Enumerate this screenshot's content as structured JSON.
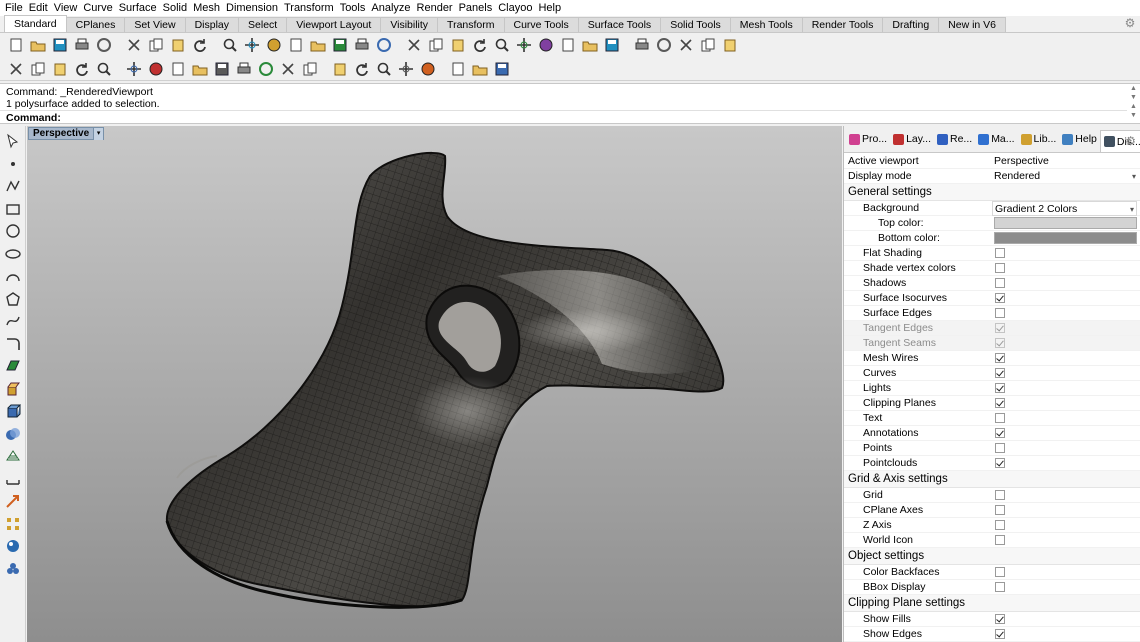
{
  "menu": [
    "File",
    "Edit",
    "View",
    "Curve",
    "Surface",
    "Solid",
    "Mesh",
    "Dimension",
    "Transform",
    "Tools",
    "Analyze",
    "Render",
    "Panels",
    "Clayoo",
    "Help"
  ],
  "tabs": [
    "Standard",
    "CPlanes",
    "Set View",
    "Display",
    "Select",
    "Viewport Layout",
    "Visibility",
    "Transform",
    "Curve Tools",
    "Surface Tools",
    "Solid Tools",
    "Mesh Tools",
    "Render Tools",
    "Drafting",
    "New in V6"
  ],
  "active_tab": "Standard",
  "command": {
    "history": [
      "Command: _RenderedViewport",
      "1 polysurface added to selection."
    ],
    "prompt": "Command:",
    "input_value": ""
  },
  "viewport": {
    "title": "Perspective",
    "menu_arrow": "▾"
  },
  "panel": {
    "tabs": [
      {
        "label": "Pro...",
        "icon": "properties-icon",
        "color": "#d04090"
      },
      {
        "label": "Lay...",
        "icon": "layers-icon",
        "color": "#c03030"
      },
      {
        "label": "Re...",
        "icon": "render-icon",
        "color": "#3060c0"
      },
      {
        "label": "Ma...",
        "icon": "materials-icon",
        "color": "#3070d0"
      },
      {
        "label": "Lib...",
        "icon": "libraries-icon",
        "color": "#d0a030"
      },
      {
        "label": "Help",
        "icon": "help-icon",
        "color": "#4080c0"
      },
      {
        "label": "Dis...",
        "icon": "display-icon",
        "color": "#405060"
      }
    ],
    "active_viewport_label": "Active viewport",
    "active_viewport_value": "Perspective",
    "display_mode_label": "Display mode",
    "display_mode_value": "Rendered",
    "sections": {
      "general": "General settings",
      "grid": "Grid & Axis settings",
      "object": "Object settings",
      "clipping": "Clipping Plane settings"
    },
    "background_label": "Background",
    "background_value": "Gradient 2 Colors",
    "top_color_label": "Top color:",
    "top_color": "#d3d3d3",
    "bottom_color_label": "Bottom color:",
    "bottom_color": "#8c8c8c",
    "general_items": [
      {
        "label": "Flat Shading",
        "checked": false,
        "dim": false
      },
      {
        "label": "Shade vertex colors",
        "checked": false,
        "dim": false
      },
      {
        "label": "Shadows",
        "checked": false,
        "dim": false
      },
      {
        "label": "Surface Isocurves",
        "checked": true,
        "dim": false
      },
      {
        "label": "Surface Edges",
        "checked": false,
        "dim": false
      },
      {
        "label": "Tangent Edges",
        "checked": true,
        "dim": true
      },
      {
        "label": "Tangent Seams",
        "checked": true,
        "dim": true
      },
      {
        "label": "Mesh Wires",
        "checked": true,
        "dim": false
      },
      {
        "label": "Curves",
        "checked": true,
        "dim": false
      },
      {
        "label": "Lights",
        "checked": true,
        "dim": false
      },
      {
        "label": "Clipping Planes",
        "checked": true,
        "dim": false
      },
      {
        "label": "Text",
        "checked": false,
        "dim": false
      },
      {
        "label": "Annotations",
        "checked": true,
        "dim": false
      },
      {
        "label": "Points",
        "checked": false,
        "dim": false
      },
      {
        "label": "Pointclouds",
        "checked": true,
        "dim": false
      }
    ],
    "grid_items": [
      {
        "label": "Grid",
        "checked": false
      },
      {
        "label": "CPlane Axes",
        "checked": false
      },
      {
        "label": "Z Axis",
        "checked": false
      },
      {
        "label": "World Icon",
        "checked": false
      }
    ],
    "object_items": [
      {
        "label": "Color Backfaces",
        "checked": false
      },
      {
        "label": "BBox Display",
        "checked": false
      }
    ],
    "clipping_items": [
      {
        "label": "Show Fills",
        "checked": true
      },
      {
        "label": "Show Edges",
        "checked": true
      }
    ]
  },
  "toolbar_icons_row1": [
    "new-file-icon",
    "open-file-icon",
    "save-icon",
    "print-icon",
    "import-icon",
    "cut-icon",
    "copy-icon",
    "paste-icon",
    "undo-icon",
    "pan-icon",
    "move-view-icon",
    "zoom-icon",
    "zoom-window-icon",
    "zoom-extents-icon",
    "zoom-selected-icon",
    "rotate-view-icon",
    "four-view-icon",
    "car-icon",
    "cplane-icon",
    "select-points-icon",
    "light-bulb-icon",
    "lock-icon",
    "layer-icon",
    "color-wheel-icon",
    "sphere-shaded-icon",
    "sphere-rendered-icon",
    "sphere-blue-icon",
    "pencil-icon",
    "options-icon",
    "select-filter-icon",
    "globe-icon",
    "help-icon"
  ],
  "toolbar_icons_row2": [
    "osnap-icon",
    "tea-pot-icon",
    "shade-icon",
    "capture-icon",
    "gumball-icon",
    "rotate-icon",
    "circle-icon",
    "angle-icon",
    "ruler-icon",
    "star-icon",
    "ring-icon",
    "sun-icon",
    "hatch-icon",
    "curve-arc-icon",
    "solid-box-icon",
    "cube-icon",
    "explode-icon",
    "plant-icon",
    "material-icon",
    "sphere-grid-icon",
    "pipe-icon",
    "crosshair-icon"
  ],
  "left_tool_icons": [
    "select-arrow-icon",
    "point-icon",
    "polyline-icon",
    "rectangle-icon",
    "circle-tool-icon",
    "ellipse-icon",
    "arc-icon",
    "polygon-icon",
    "curve-tool-icon",
    "fillet-icon",
    "surface-icon",
    "extrude-icon",
    "solid-box-tool-icon",
    "boolean-icon",
    "mesh-icon",
    "dimension-icon",
    "transform-icon",
    "array-icon",
    "analysis-icon",
    "render-tool-icon"
  ]
}
